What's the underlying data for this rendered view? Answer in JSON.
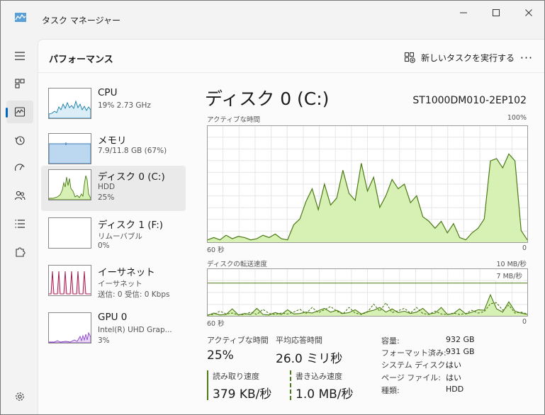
{
  "window": {
    "title": "タスク マネージャー"
  },
  "header": {
    "page_title": "パフォーマンス",
    "new_task_label": "新しいタスクを実行する",
    "more_label": "···"
  },
  "sidebar": {
    "items": [
      {
        "name": "CPU",
        "sub1": "19%  2.73 GHz",
        "sub2": "",
        "sub3": ""
      },
      {
        "name": "メモリ",
        "sub1": "7.9/11.8 GB (67%)",
        "sub2": "",
        "sub3": ""
      },
      {
        "name": "ディスク 0 (C:)",
        "sub1": "HDD",
        "sub2": "25%",
        "sub3": ""
      },
      {
        "name": "ディスク 1 (F:)",
        "sub1": "リムーバブル",
        "sub2": "0%",
        "sub3": ""
      },
      {
        "name": "イーサネット",
        "sub1": "イーサネット",
        "sub2": "送信: 0 受信: 0 Kbps",
        "sub3": ""
      },
      {
        "name": "GPU 0",
        "sub1": "Intel(R) UHD Grap...",
        "sub2": "3%",
        "sub3": ""
      }
    ]
  },
  "detail": {
    "title": "ディスク 0 (C:)",
    "model": "ST1000DM010-2EP102",
    "active_chart": {
      "label": "アクティブな時間",
      "max_label": "100%",
      "time_label": "60 秒",
      "min_label": "0"
    },
    "transfer_chart": {
      "label": "ディスクの転送速度",
      "max_label": "10 MB/秒",
      "marker_label": "7 MB/秒",
      "time_label": "60 秒",
      "min_label": "0"
    },
    "stats": {
      "active_time_label": "アクティブな時間",
      "active_time_value": "25%",
      "avg_response_label": "平均応答時間",
      "avg_response_value": "26.0 ミリ秒",
      "read_label": "読み取り速度",
      "read_value": "379 KB/秒",
      "write_label": "書き込み速度",
      "write_value": "1.0 MB/秒"
    },
    "properties": [
      {
        "label": "容量:",
        "value": "932 GB"
      },
      {
        "label": "フォーマット済み:",
        "value": "931 GB"
      },
      {
        "label": "システム ディスク:",
        "value": "はい"
      },
      {
        "label": "ページ ファイル:",
        "value": "はい"
      },
      {
        "label": "種類:",
        "value": "HDD"
      }
    ]
  },
  "colors": {
    "disk_fill": "#d7f0b4",
    "disk_line": "#4b7a16",
    "cpu_line": "#1179a8",
    "memory_fill": "#bcd8f0",
    "ethernet_line": "#a61e54",
    "gpu_line": "#8a45c5"
  },
  "chart_data": [
    {
      "type": "area",
      "title": "アクティブな時間",
      "x_range": [
        60,
        0
      ],
      "ylim": [
        0,
        100
      ],
      "series": [
        {
          "values": [
            2,
            4,
            2,
            6,
            3,
            5,
            4,
            2,
            3,
            6,
            4,
            7,
            3,
            2,
            15,
            20,
            35,
            46,
            28,
            50,
            32,
            38,
            62,
            42,
            36,
            68,
            44,
            56,
            30,
            40,
            54,
            46,
            50,
            34,
            40,
            22,
            18,
            12,
            18,
            8,
            16,
            4,
            2,
            8,
            12,
            20,
            70,
            72,
            64,
            76,
            70,
            10,
            2
          ]
        }
      ]
    },
    {
      "type": "line",
      "title": "ディスクの転送速度",
      "x_range": [
        60,
        0
      ],
      "ylim": [
        0,
        10
      ],
      "series": [
        {
          "values": [
            0.2,
            0.3,
            1.0,
            0.4,
            0.6,
            0.2,
            0.3,
            0.8,
            0.3,
            1.4,
            0.5,
            0.3,
            0.6,
            0.4,
            0.8,
            1.4,
            0.5,
            1.8,
            0.7,
            1.3,
            2.0,
            1.0,
            0.4,
            1.8,
            0.6,
            0.3,
            0.8,
            2.5,
            1.0,
            2.8,
            0.7,
            1.1,
            1.6,
            0.6,
            1.8,
            0.5,
            0.3,
            1.0,
            0.4,
            0.3,
            0.6,
            0.3,
            0.5,
            1.2,
            0.6,
            0.9,
            2.6,
            2.8,
            1.2,
            2.3,
            0.6,
            0.8,
            0.4
          ]
        },
        {
          "values": [
            0.1,
            0.6,
            0.2,
            0.3,
            1.5,
            0.2,
            0.5,
            0.3,
            1.6,
            0.3,
            0.2,
            0.7,
            0.3,
            1.3,
            0.4,
            0.5,
            0.8,
            0.6,
            1.1,
            1.6,
            0.8,
            1.2,
            0.5,
            0.7,
            1.3,
            0.4,
            0.9,
            1.2,
            1.8,
            0.8,
            1.5,
            0.7,
            1.0,
            0.5,
            0.8,
            1.6,
            0.4,
            0.6,
            1.8,
            0.3,
            0.5,
            1.5,
            0.4,
            0.8,
            1.3,
            1.2,
            4.5,
            1.5,
            0.8,
            3.0,
            1.0,
            0.6,
            0.3
          ]
        }
      ]
    }
  ]
}
